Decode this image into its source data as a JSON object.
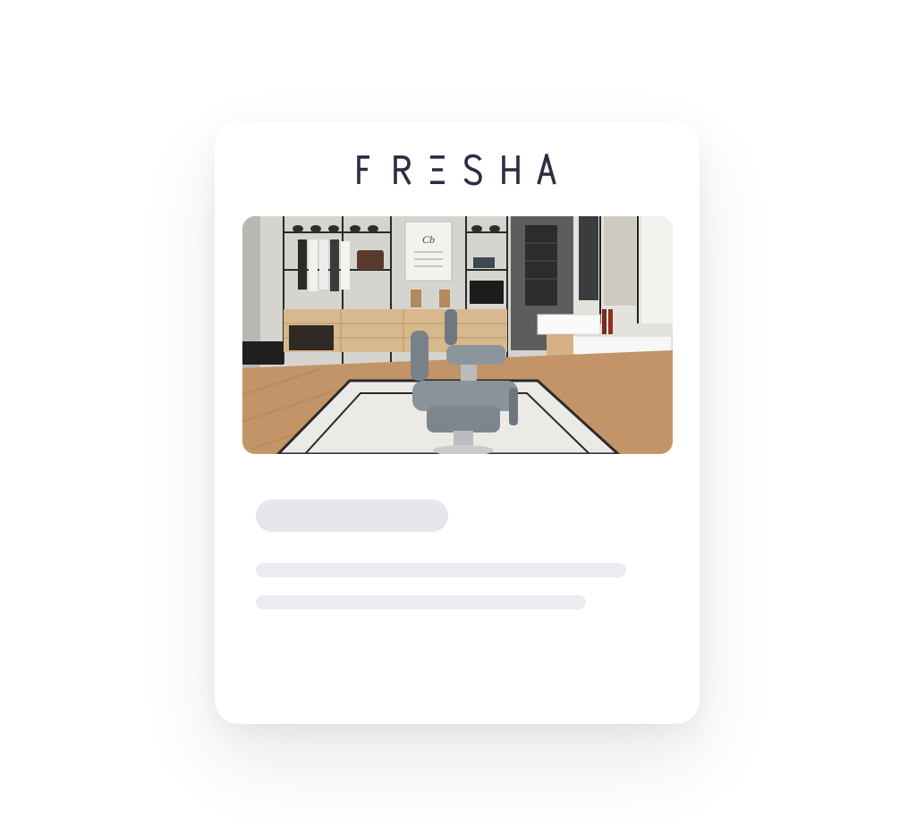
{
  "brand": {
    "name": "FRESHA",
    "color": "#2b2d42"
  },
  "hero_image": {
    "subject": "barbershop-interior"
  },
  "skeleton": {
    "title_color": "#e4e6eb",
    "line_color": "#ebecf0"
  }
}
